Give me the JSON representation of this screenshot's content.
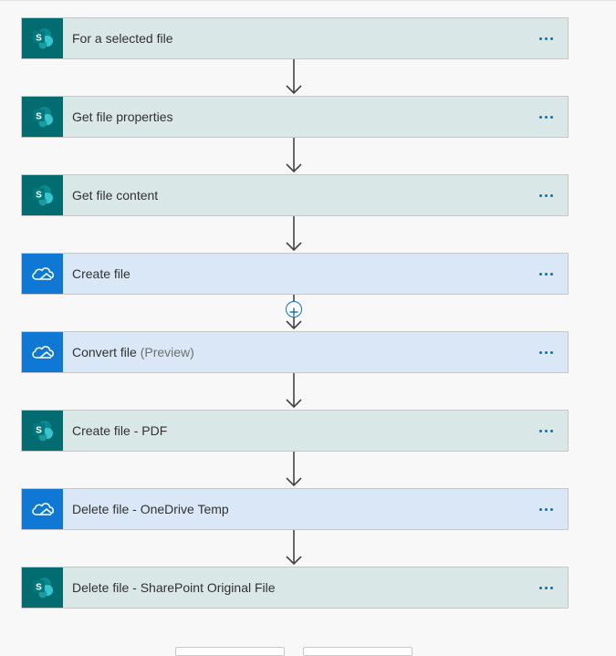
{
  "steps": [
    {
      "id": "for-a-selected-file",
      "label": "For a selected file",
      "suffix": "",
      "connector": "sharepoint"
    },
    {
      "id": "get-file-properties",
      "label": "Get file properties",
      "suffix": "",
      "connector": "sharepoint"
    },
    {
      "id": "get-file-content",
      "label": "Get file content",
      "suffix": "",
      "connector": "sharepoint"
    },
    {
      "id": "create-file",
      "label": "Create file",
      "suffix": "",
      "connector": "onedrive"
    },
    {
      "id": "convert-file",
      "label": "Convert file",
      "suffix": "(Preview)",
      "connector": "onedrive"
    },
    {
      "id": "create-file-pdf",
      "label": "Create file - PDF",
      "suffix": "",
      "connector": "sharepoint"
    },
    {
      "id": "delete-file-onedrive-temp",
      "label": "Delete file - OneDrive Temp",
      "suffix": "",
      "connector": "onedrive"
    },
    {
      "id": "delete-file-sharepoint-original",
      "label": "Delete file - SharePoint Original File",
      "suffix": "",
      "connector": "sharepoint"
    }
  ],
  "icons": {
    "sharepoint": "sharepoint-icon",
    "onedrive": "onedrive-icon",
    "more": "more-options-icon",
    "arrow": "arrow-down-icon",
    "add": "plus-icon"
  },
  "colors": {
    "sharepoint_icon_bg": "#036c70",
    "sharepoint_card_bg": "#dae7e7",
    "onedrive_icon_bg": "#0f78d4",
    "onedrive_card_bg": "#d9e7f7",
    "accent": "#0f6cbd"
  }
}
